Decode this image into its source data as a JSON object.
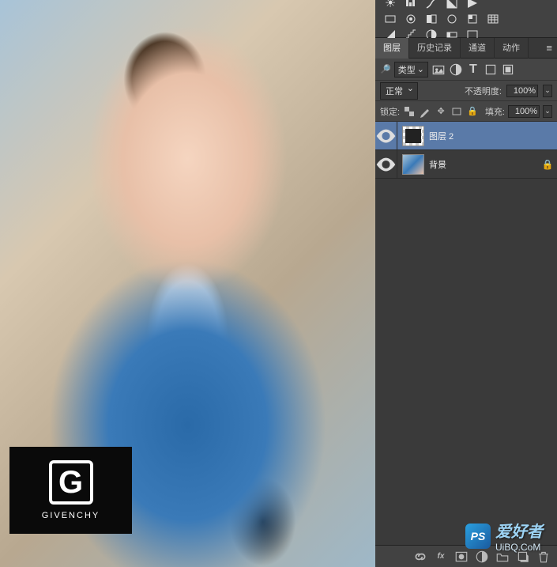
{
  "logo": {
    "letter": "G",
    "brand": "GIVENCHY"
  },
  "panel": {
    "tabs": [
      "图层",
      "历史记录",
      "通道",
      "动作"
    ],
    "active_tab_index": 0,
    "filter_label": "类型",
    "blend_mode": "正常",
    "opacity_label": "不透明度:",
    "opacity_value": "100%",
    "lock_label": "锁定:",
    "fill_label": "填充:",
    "fill_value": "100%"
  },
  "layers": [
    {
      "name": "图层 2",
      "visible": true,
      "locked": false,
      "selected": true,
      "thumb": "pattern"
    },
    {
      "name": "背景",
      "visible": true,
      "locked": true,
      "selected": false,
      "thumb": "photo"
    }
  ],
  "watermark": {
    "badge": "PS",
    "main": "爱好者",
    "url": "UiBQ.CoM"
  }
}
